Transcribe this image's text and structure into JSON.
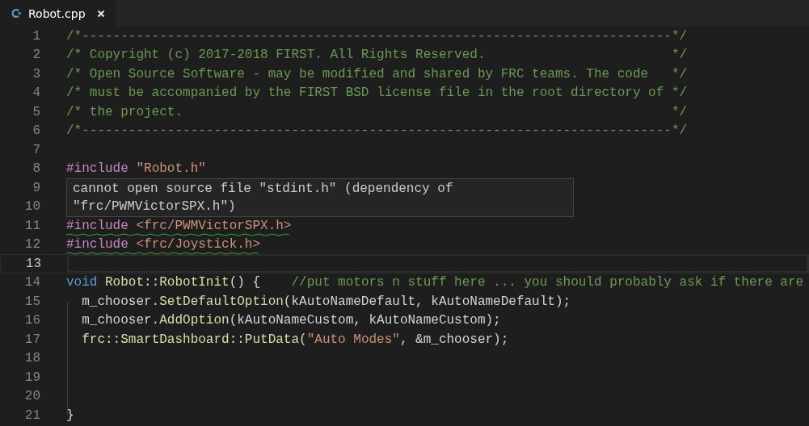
{
  "tabs": [
    {
      "label": "Robot.cpp",
      "selected": true
    }
  ],
  "lines": [
    {
      "number": "1",
      "current": false,
      "squiggle": false,
      "tokens": [
        {
          "kind": "comment",
          "text": "/*----------------------------------------------------------------------------*/"
        }
      ]
    },
    {
      "number": "2",
      "current": false,
      "squiggle": false,
      "tokens": [
        {
          "kind": "comment",
          "text": "/* Copyright (c) 2017-2018 FIRST. All Rights Reserved.                        */"
        }
      ]
    },
    {
      "number": "3",
      "current": false,
      "squiggle": false,
      "tokens": [
        {
          "kind": "comment",
          "text": "/* Open Source Software - may be modified and shared by FRC teams. The code   */"
        }
      ]
    },
    {
      "number": "4",
      "current": false,
      "squiggle": false,
      "tokens": [
        {
          "kind": "comment",
          "text": "/* must be accompanied by the FIRST BSD license file in the root directory of */"
        }
      ]
    },
    {
      "number": "5",
      "current": false,
      "squiggle": false,
      "tokens": [
        {
          "kind": "comment",
          "text": "/* the project.                                                               */"
        }
      ]
    },
    {
      "number": "6",
      "current": false,
      "squiggle": false,
      "tokens": [
        {
          "kind": "comment",
          "text": "/*----------------------------------------------------------------------------*/"
        }
      ]
    },
    {
      "number": "7",
      "current": false
    },
    {
      "number": "8",
      "current": false,
      "squiggle": false,
      "tokens": [
        {
          "kind": "preproc",
          "text": "#include "
        },
        {
          "kind": "string",
          "text": "\"Robot.h\""
        }
      ]
    },
    {
      "number": "9",
      "current": false
    },
    {
      "number": "10",
      "current": false
    },
    {
      "number": "11",
      "current": false,
      "squiggle": true,
      "tokens": [
        {
          "kind": "preproc",
          "text": "#include "
        },
        {
          "kind": "string",
          "text": "<frc/PWMVictorSPX.h>"
        }
      ]
    },
    {
      "number": "12",
      "current": false,
      "squiggle": true,
      "tokens": [
        {
          "kind": "preproc",
          "text": "#include "
        },
        {
          "kind": "string",
          "text": "<frc/Joystick.h>"
        }
      ]
    },
    {
      "number": "13",
      "current": true
    },
    {
      "number": "14",
      "current": false,
      "squiggle": false,
      "tokens": [
        {
          "kind": "keyword",
          "text": "void "
        },
        {
          "kind": "type",
          "text": "Robot"
        },
        {
          "kind": "plain",
          "text": "::"
        },
        {
          "kind": "function",
          "text": "RobotInit"
        },
        {
          "kind": "plain",
          "text": "() {    "
        },
        {
          "kind": "comment",
          "text": "//put motors n stuff here ... you should probably ask if there are"
        }
      ]
    },
    {
      "number": "15",
      "current": false,
      "squiggle": false,
      "tokens": [
        {
          "kind": "plain",
          "text": "  m_chooser."
        },
        {
          "kind": "function",
          "text": "SetDefaultOption"
        },
        {
          "kind": "plain",
          "text": "(kAutoNameDefault, kAutoNameDefault);"
        }
      ]
    },
    {
      "number": "16",
      "current": false,
      "squiggle": false,
      "tokens": [
        {
          "kind": "plain",
          "text": "  m_chooser."
        },
        {
          "kind": "function",
          "text": "AddOption"
        },
        {
          "kind": "plain",
          "text": "(kAutoNameCustom, kAutoNameCustom);"
        }
      ]
    },
    {
      "number": "17",
      "current": false,
      "squiggle": false,
      "tokens": [
        {
          "kind": "type",
          "text": "  frc"
        },
        {
          "kind": "plain",
          "text": "::"
        },
        {
          "kind": "type",
          "text": "SmartDashboard"
        },
        {
          "kind": "plain",
          "text": "::"
        },
        {
          "kind": "function",
          "text": "PutData"
        },
        {
          "kind": "plain",
          "text": "("
        },
        {
          "kind": "string",
          "text": "\"Auto Modes\""
        },
        {
          "kind": "plain",
          "text": ", &m_chooser);"
        }
      ]
    },
    {
      "number": "18",
      "current": false
    },
    {
      "number": "19",
      "current": false
    },
    {
      "number": "20",
      "current": false
    },
    {
      "number": "21",
      "current": false,
      "squiggle": false,
      "tokens": [
        {
          "kind": "plain",
          "text": "}"
        }
      ]
    }
  ],
  "tooltip": {
    "text": "cannot open source file \"stdint.h\" (dependency of \"frc/PWMVictorSPX.h\")"
  }
}
